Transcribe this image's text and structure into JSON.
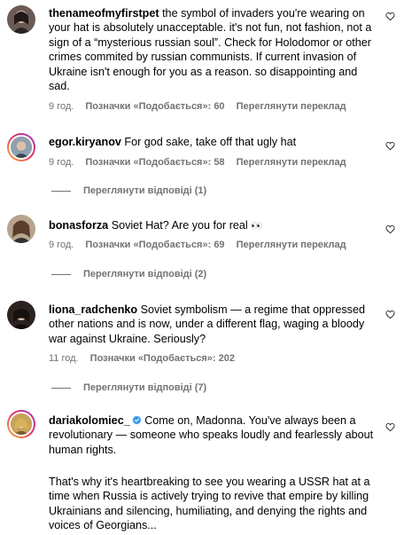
{
  "comments": [
    {
      "username": "thenameofmyfirstpet",
      "text": "the symbol of invaders you're wearing on your hat is absolutely unacceptable. it's not fun, not fashion, not a sign of a “mysterious russian soul”. Check for Holodomor or other crimes commited by russian communists. If current invasion of Ukraine isn't enough for you as a reason. so disappointing and sad.",
      "time": "9 год.",
      "likes": "Позначки «Подобається»: 60",
      "translate": "Переглянути переклад"
    },
    {
      "username": "egor.kiryanov",
      "text": "For god sake, take off that ugly hat",
      "time": "9 год.",
      "likes": "Позначки «Подобається»: 58",
      "translate": "Переглянути переклад",
      "replies": "Переглянути відповіді (1)"
    },
    {
      "username": "bonasforza",
      "text": "Soviet Hat? Are you for real",
      "emoji": "👀",
      "time": "9 год.",
      "likes": "Позначки «Подобається»: 69",
      "translate": "Переглянути переклад",
      "replies": "Переглянути відповіді (2)"
    },
    {
      "username": "liona_radchenko",
      "text": "Soviet symbolism — a regime that oppressed other nations and is now, under a different flag, waging a bloody war against Ukraine. Seriously?",
      "time": "11 год.",
      "likes": "Позначки «Подобається»: 202",
      "replies": "Переглянути відповіді (7)"
    },
    {
      "username": "dariakolomiec_",
      "verified": true,
      "text": "Come on, Madonna. You've always been a revolutionary — someone who speaks loudly and fearlessly about human rights.",
      "text2": "That's why it's heartbreaking to see you wearing a USSR hat at a time when Russia is actively trying to revive that empire by killing Ukrainians and silencing, humiliating, and denying the rights and voices of Georgians..."
    }
  ],
  "icons": {
    "like": "heart-outline-icon",
    "verified": "verified-badge-icon"
  },
  "colors": {
    "secondary_text": "#737373",
    "verified": "#3897f0"
  }
}
